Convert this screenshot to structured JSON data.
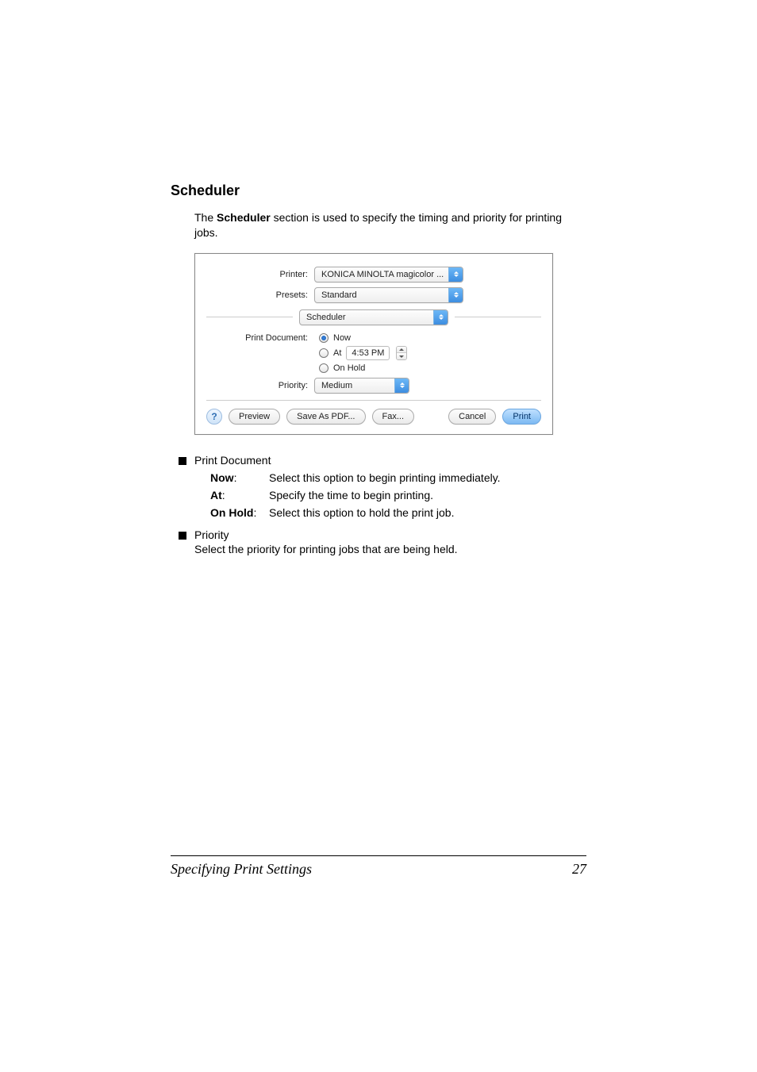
{
  "heading": "Scheduler",
  "intro_pre": "The ",
  "intro_bold": "Scheduler",
  "intro_post": " section is used to specify the timing and priority for printing jobs.",
  "dialog": {
    "printer_label": "Printer:",
    "printer_value": "KONICA MINOLTA magicolor ...",
    "presets_label": "Presets:",
    "presets_value": "Standard",
    "section_value": "Scheduler",
    "print_doc_label": "Print Document:",
    "opt_now": "Now",
    "opt_at": "At",
    "opt_at_time": "4:53 PM",
    "opt_hold": "On Hold",
    "priority_label": "Priority:",
    "priority_value": "Medium",
    "help": "?",
    "preview": "Preview",
    "save_pdf": "Save As PDF...",
    "fax": "Fax...",
    "cancel": "Cancel",
    "print": "Print"
  },
  "list": {
    "item1": "Print Document",
    "defs": [
      {
        "k": "Now",
        "c": ":",
        "v": "Select this option to begin printing immediately."
      },
      {
        "k": "At",
        "c": ":",
        "v": "Specify the time to begin printing."
      },
      {
        "k": "On Hold",
        "c": ":",
        "v": "Select this option to hold the print job."
      }
    ],
    "item2": "Priority",
    "item2_desc": "Select the priority for printing jobs that are being held."
  },
  "footer": {
    "title": "Specifying Print Settings",
    "page": "27"
  }
}
